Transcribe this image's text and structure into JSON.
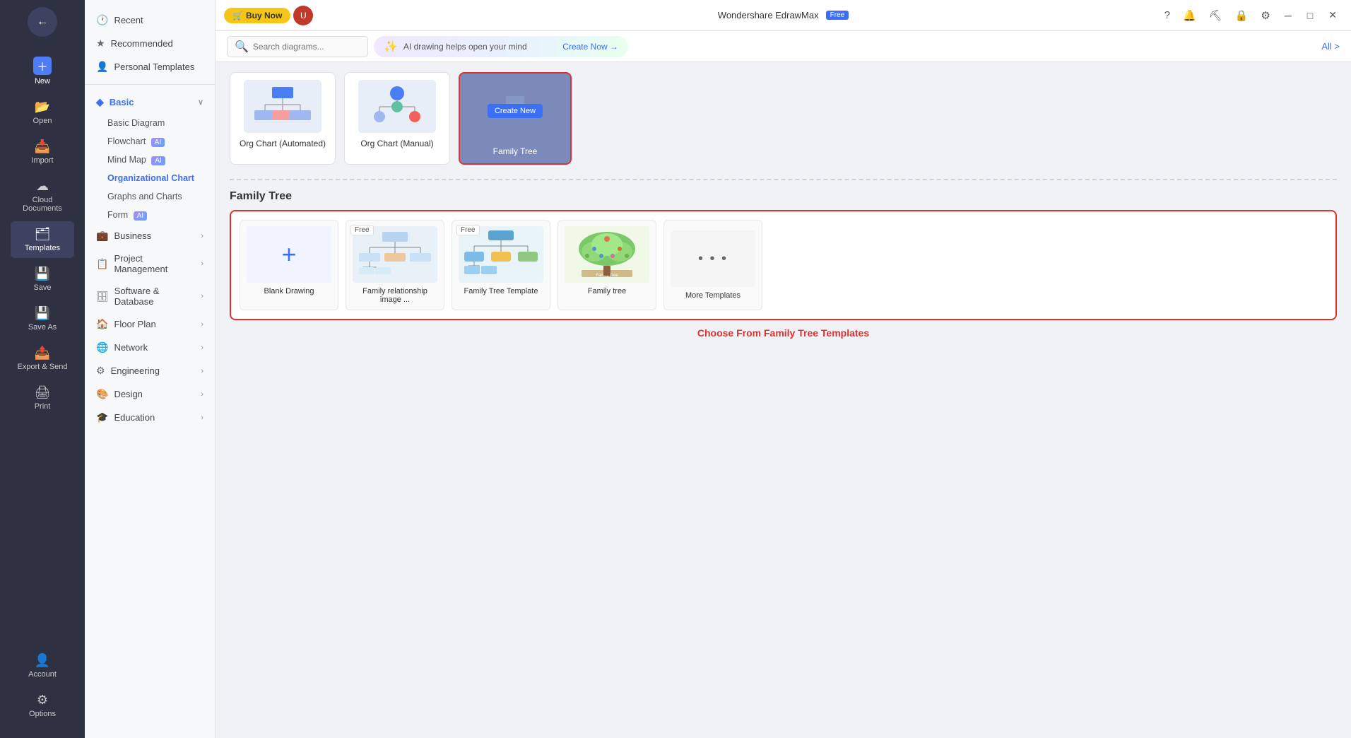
{
  "app": {
    "title": "Wondershare EdrawMax",
    "free_badge": "Free",
    "buy_now": "Buy Now"
  },
  "left_sidebar": {
    "items": [
      {
        "id": "new",
        "label": "New",
        "icon": "＋"
      },
      {
        "id": "open",
        "label": "Open",
        "icon": "📁"
      },
      {
        "id": "import",
        "label": "Import",
        "icon": "📥"
      },
      {
        "id": "cloud",
        "label": "Cloud Documents",
        "icon": "☁"
      },
      {
        "id": "templates",
        "label": "Templates",
        "icon": "🗂"
      },
      {
        "id": "save",
        "label": "Save",
        "icon": "💾"
      },
      {
        "id": "save_as",
        "label": "Save As",
        "icon": "💾"
      },
      {
        "id": "export",
        "label": "Export & Send",
        "icon": "📤"
      },
      {
        "id": "print",
        "label": "Print",
        "icon": "🖨"
      }
    ],
    "bottom_items": [
      {
        "id": "account",
        "label": "Account",
        "icon": "👤"
      },
      {
        "id": "options",
        "label": "Options",
        "icon": "⚙"
      }
    ]
  },
  "second_sidebar": {
    "items": [
      {
        "id": "recent",
        "label": "Recent",
        "icon": "🕐",
        "active": false
      },
      {
        "id": "recommended",
        "label": "Recommended",
        "icon": "★",
        "active": false
      },
      {
        "id": "personal",
        "label": "Personal Templates",
        "icon": "👤",
        "active": false
      }
    ],
    "categories": [
      {
        "id": "basic",
        "label": "Basic",
        "active": true,
        "expanded": true,
        "subitems": [
          {
            "id": "basic_diagram",
            "label": "Basic Diagram",
            "active": false
          },
          {
            "id": "flowchart",
            "label": "Flowchart",
            "active": false,
            "ai": true
          },
          {
            "id": "mind_map",
            "label": "Mind Map",
            "active": false,
            "ai": true
          },
          {
            "id": "org_chart",
            "label": "Organizational Chart",
            "active": true
          },
          {
            "id": "graphs",
            "label": "Graphs and Charts",
            "active": false
          },
          {
            "id": "form",
            "label": "Form",
            "active": false,
            "ai": true
          }
        ]
      },
      {
        "id": "business",
        "label": "Business",
        "active": false
      },
      {
        "id": "project",
        "label": "Project Management",
        "active": false
      },
      {
        "id": "software_db",
        "label": "Software & Database",
        "active": false
      },
      {
        "id": "floor_plan",
        "label": "Floor Plan",
        "active": false
      },
      {
        "id": "network",
        "label": "Network",
        "active": false
      },
      {
        "id": "engineering",
        "label": "Engineering",
        "active": false
      },
      {
        "id": "design",
        "label": "Design",
        "active": false
      },
      {
        "id": "education",
        "label": "Education",
        "active": false
      }
    ]
  },
  "toolbar": {
    "search_placeholder": "Search diagrams...",
    "ai_promo_text": "AI drawing helps open your mind",
    "ai_promo_btn": "Create Now →",
    "all_label": "All >"
  },
  "top_templates": [
    {
      "id": "org_auto",
      "label": "Org Chart (Automated)",
      "type": "org_auto"
    },
    {
      "id": "org_manual",
      "label": "Org Chart (Manual)",
      "type": "org_manual"
    },
    {
      "id": "family_tree",
      "label": "Family Tree",
      "type": "family_tree",
      "selected": true
    }
  ],
  "family_tree_section": {
    "title": "Family Tree",
    "templates": [
      {
        "id": "blank",
        "label": "Blank Drawing",
        "type": "blank"
      },
      {
        "id": "family_rel",
        "label": "Family relationship image ...",
        "type": "family_rel",
        "free": true
      },
      {
        "id": "ft_template",
        "label": "Family Tree Template",
        "type": "ft_template",
        "free": true
      },
      {
        "id": "family_tree_img",
        "label": "Family tree",
        "type": "family_tree_img"
      },
      {
        "id": "more",
        "label": "More Templates",
        "type": "more"
      }
    ],
    "choose_label": "Choose From Family Tree Templates"
  }
}
